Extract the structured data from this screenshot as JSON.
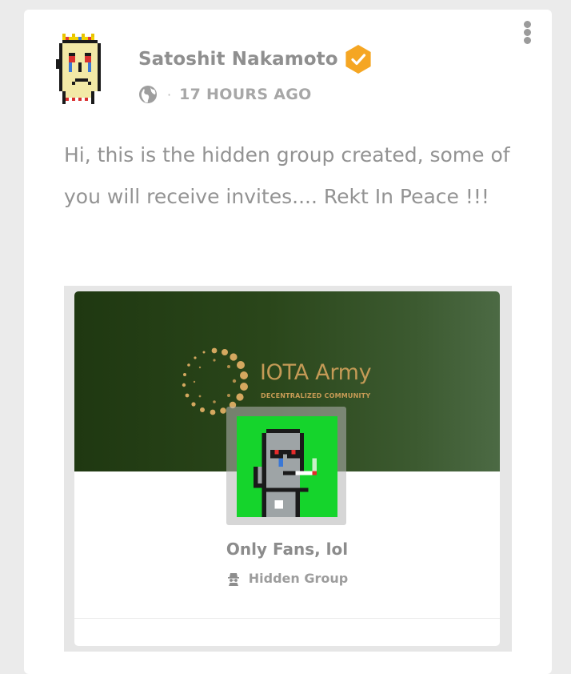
{
  "post": {
    "author_name": "Satoshit Nakamoto",
    "timestamp": "17 HOURS AGO",
    "separator": "·",
    "text": "Hi, this is the hidden group created, some of you will receive invites.... Rekt In Peace !!!"
  },
  "shared_group": {
    "cover_brand_title": "IOTA Army",
    "cover_brand_subtitle": "DECENTRALIZED COMMUNITY",
    "name": "Only Fans, lol",
    "privacy_label": "Hidden Group"
  },
  "icons": {
    "verified": "verified-badge-icon",
    "privacy": "globe-icon",
    "more": "more-options-icon",
    "hidden": "spy-icon"
  },
  "colors": {
    "verified_badge": "#f5a623",
    "cover_green": "#2a461a",
    "group_avatar_bg": "#15d42c",
    "brand_gold": "#c49a56"
  }
}
